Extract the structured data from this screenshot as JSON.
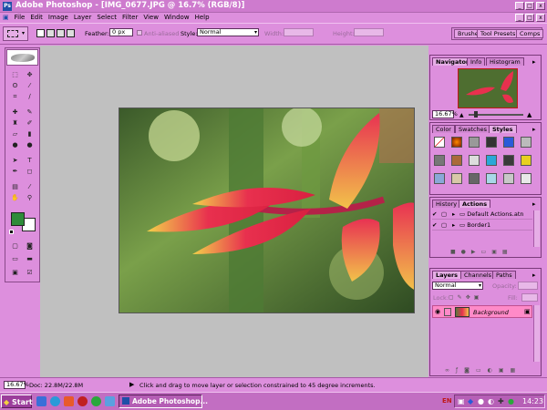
{
  "window": {
    "title": "Adobe Photoshop - [IMG_0677.JPG @ 16.7% (RGB/8)]",
    "icon": "photoshop-icon"
  },
  "menu": [
    "File",
    "Edit",
    "Image",
    "Layer",
    "Select",
    "Filter",
    "View",
    "Window",
    "Help"
  ],
  "options": {
    "feather_label": "Feather:",
    "feather_value": "0 px",
    "antialiased_label": "Anti-aliased",
    "style_label": "Style:",
    "style_value": "Normal",
    "width_label": "Width:",
    "height_label": "Height:",
    "well_tabs": [
      "Brushes",
      "Tool Presets",
      "Comps"
    ]
  },
  "navigator": {
    "tabs": [
      "Navigator",
      "Info",
      "Histogram"
    ],
    "zoom": "16.67%"
  },
  "styles_panel": {
    "tabs": [
      "Color",
      "Swatches",
      "Styles"
    ]
  },
  "actions_panel": {
    "tabs": [
      "History",
      "Actions"
    ],
    "items": [
      "Default Actions.atn",
      "Border1"
    ]
  },
  "layers_panel": {
    "tabs": [
      "Layers",
      "Channels",
      "Paths"
    ],
    "blend_mode": "Normal",
    "opacity_label": "Opacity:",
    "lock_label": "Lock:",
    "fill_label": "Fill:",
    "layer_name": "Background"
  },
  "status": {
    "zoom": "16.67%",
    "doc": "Doc: 22.8M/22.8M",
    "hint": "Click and drag to move layer or selection constrained to 45 degree increments."
  },
  "taskbar": {
    "start": "Start",
    "task": "Adobe Photoshop...",
    "lang": "EN",
    "clock": "14:23"
  },
  "colors": {
    "ui_pink": "#dd8fdd",
    "foreground": "#2e8b3a",
    "background": "#ffffff",
    "layer_highlight": "#ff8ac8"
  }
}
